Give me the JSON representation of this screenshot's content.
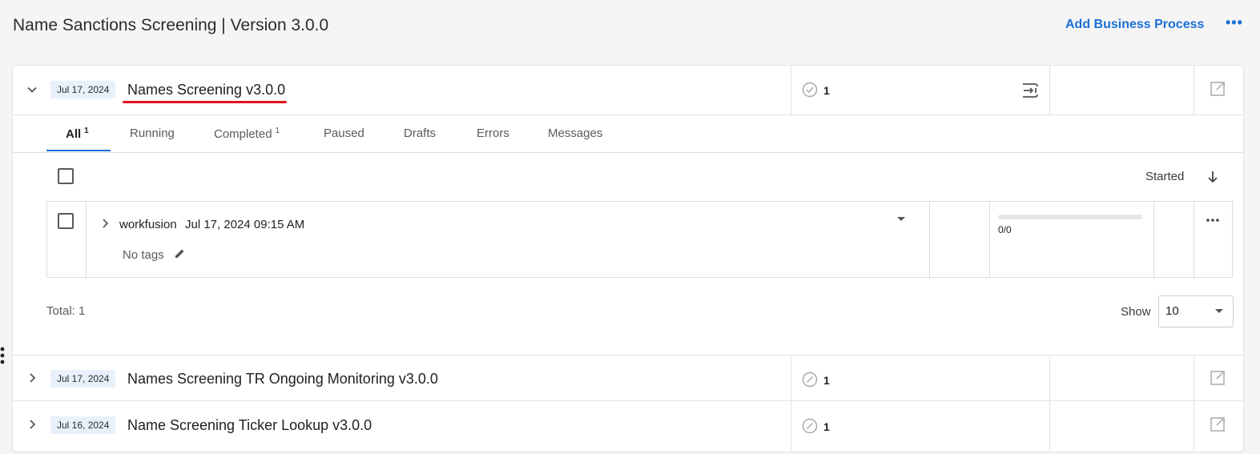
{
  "header": {
    "title": "Name Sanctions Screening | Version 3.0.0",
    "add_button": "Add Business Process",
    "more_icon": "more-horizontal-icon"
  },
  "colors": {
    "accent": "#1a6fd6",
    "highlight": "#e0141e",
    "badge_bg": "#e8f1fb"
  },
  "processes": [
    {
      "date": "Jul 17, 2024",
      "name": "Names Screening v3.0.0",
      "count": "1",
      "expanded": true
    },
    {
      "date": "Jul 17, 2024",
      "name": "Names Screening TR Ongoing Monitoring v3.0.0",
      "count": "1",
      "expanded": false
    },
    {
      "date": "Jul 16, 2024",
      "name": "Name Screening Ticker Lookup v3.0.0",
      "count": "1",
      "expanded": false
    }
  ],
  "tabs": [
    {
      "label": "All",
      "count": "1",
      "active": true
    },
    {
      "label": "Running",
      "count": ""
    },
    {
      "label": "Completed",
      "count": "1"
    },
    {
      "label": "Paused",
      "count": ""
    },
    {
      "label": "Drafts",
      "count": ""
    },
    {
      "label": "Errors",
      "count": ""
    },
    {
      "label": "Messages",
      "count": ""
    }
  ],
  "sort": {
    "label": "Started",
    "direction": "descending"
  },
  "instance": {
    "user": "workfusion",
    "date": "Jul 17, 2024 09:15 AM",
    "tags": "No tags",
    "progress_text": "0/0",
    "progress_fraction": 0
  },
  "footer": {
    "total": "Total: 1",
    "show_label": "Show",
    "page_size": "10"
  }
}
